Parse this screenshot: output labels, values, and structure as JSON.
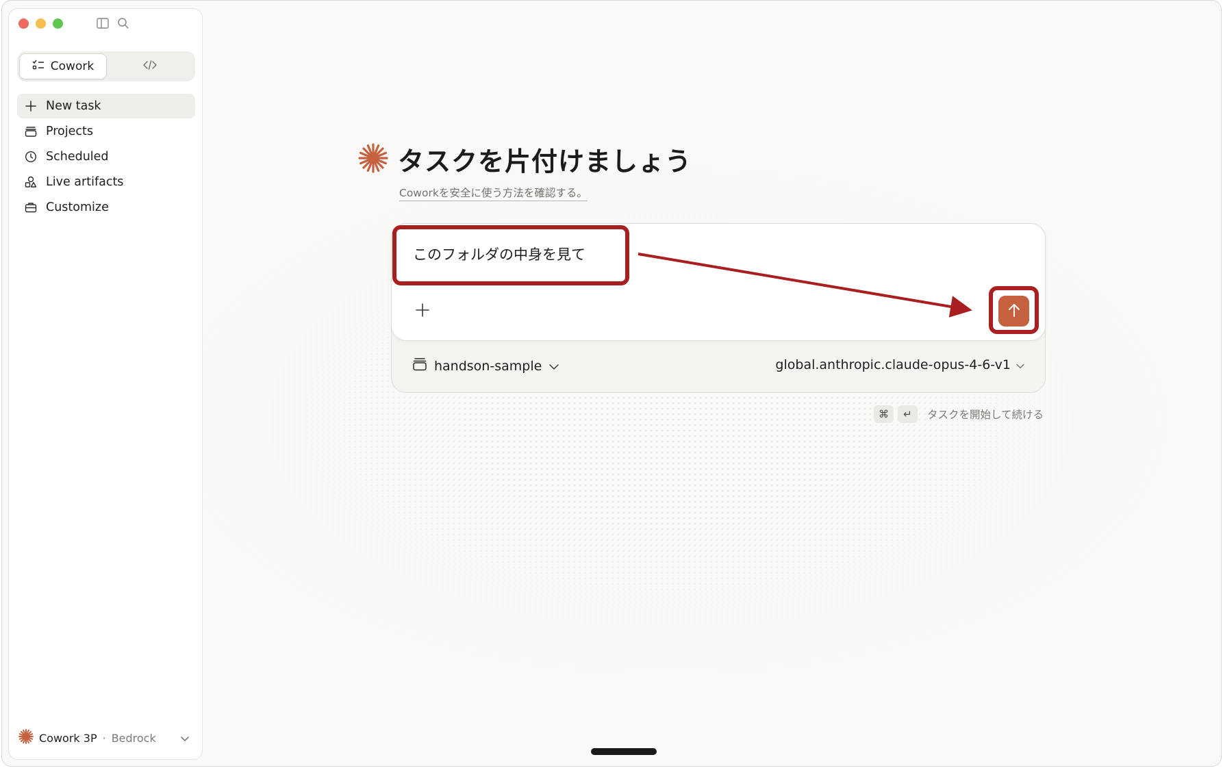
{
  "sidebar": {
    "mode_tabs": [
      {
        "label": "Cowork",
        "icon": "checklist-icon"
      },
      {
        "label": "",
        "icon": "code-icon"
      }
    ],
    "nav": [
      {
        "label": "New task",
        "icon": "plus-icon"
      },
      {
        "label": "Projects",
        "icon": "folder-stack-icon"
      },
      {
        "label": "Scheduled",
        "icon": "clock-icon"
      },
      {
        "label": "Live artifacts",
        "icon": "shapes-icon"
      },
      {
        "label": "Customize",
        "icon": "briefcase-icon"
      }
    ],
    "footer": {
      "name": "Cowork 3P",
      "separator": "·",
      "sub": "Bedrock"
    }
  },
  "main": {
    "title": "タスクを片付けましょう",
    "subtitle_link": "Coworkを安全に使う方法を確認する",
    "subtitle_suffix": "。",
    "prompt_text": "このフォルダの中身を見て",
    "folder": "handson-sample",
    "model": "global.anthropic.claude-opus-4-6-v1",
    "hint": {
      "key1": "⌘",
      "key2": "↵",
      "text": "タスクを開始して続ける"
    }
  },
  "colors": {
    "accent": "#c6613f",
    "annotation": "#a91e1e",
    "background": "#faf9f7"
  }
}
